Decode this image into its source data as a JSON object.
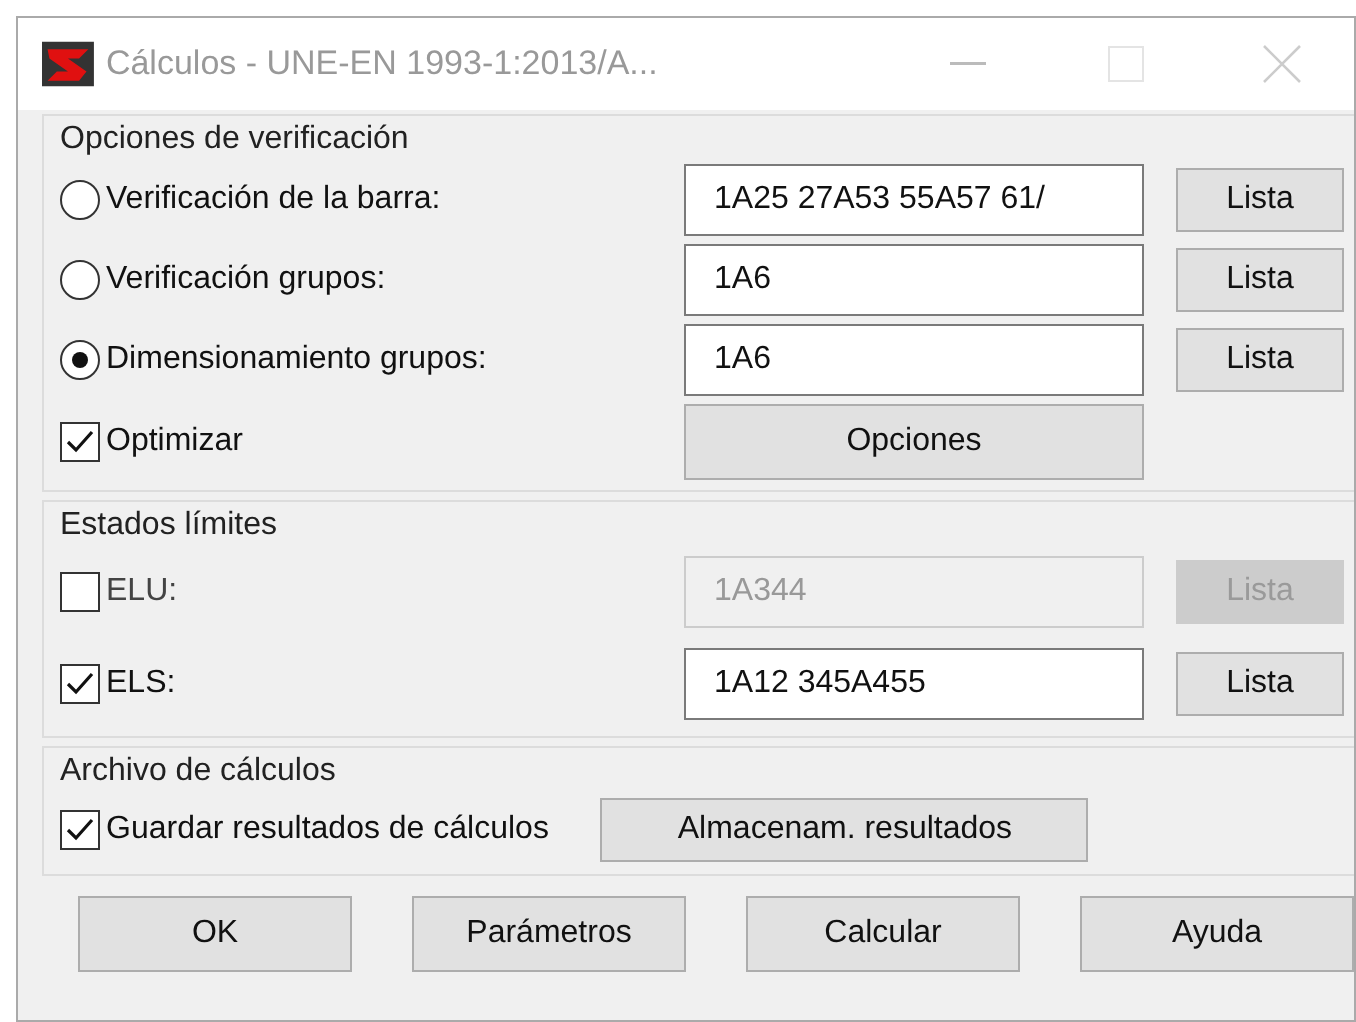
{
  "window": {
    "title": "Cálculos - UNE-EN 1993-1:2013/A..."
  },
  "groups": [
    {
      "title": "Opciones de verificación",
      "rows": [
        {
          "kind": "radio",
          "label": "Verificación de la barra:",
          "selected": false,
          "value": "1A25 27A53 55A57 61/",
          "button": "Lista",
          "disabled": false
        },
        {
          "kind": "radio",
          "label": "Verificación grupos:",
          "selected": false,
          "value": "1A6",
          "button": "Lista",
          "disabled": false
        },
        {
          "kind": "radio",
          "label": "Dimensionamiento grupos:",
          "selected": true,
          "value": "1A6",
          "button": "Lista",
          "disabled": false
        },
        {
          "kind": "checkbox-wide",
          "label": "Optimizar",
          "checked": true,
          "button": "Opciones"
        }
      ]
    },
    {
      "title": "Estados límites",
      "rows": [
        {
          "kind": "checkbox",
          "label": "ELU:",
          "checked": false,
          "value": "1A344",
          "button": "Lista",
          "disabled": true
        },
        {
          "kind": "checkbox",
          "label": "ELS:",
          "checked": true,
          "value": "1A12 345A455",
          "button": "Lista",
          "disabled": false
        }
      ]
    },
    {
      "title": "Archivo de cálculos",
      "rows": [
        {
          "kind": "checkbox-button",
          "label": "Guardar resultados de cálculos",
          "checked": true,
          "button": "Almacenam. resultados"
        }
      ]
    }
  ],
  "buttons": [
    "OK",
    "Parámetros",
    "Calcular",
    "Ayuda"
  ]
}
